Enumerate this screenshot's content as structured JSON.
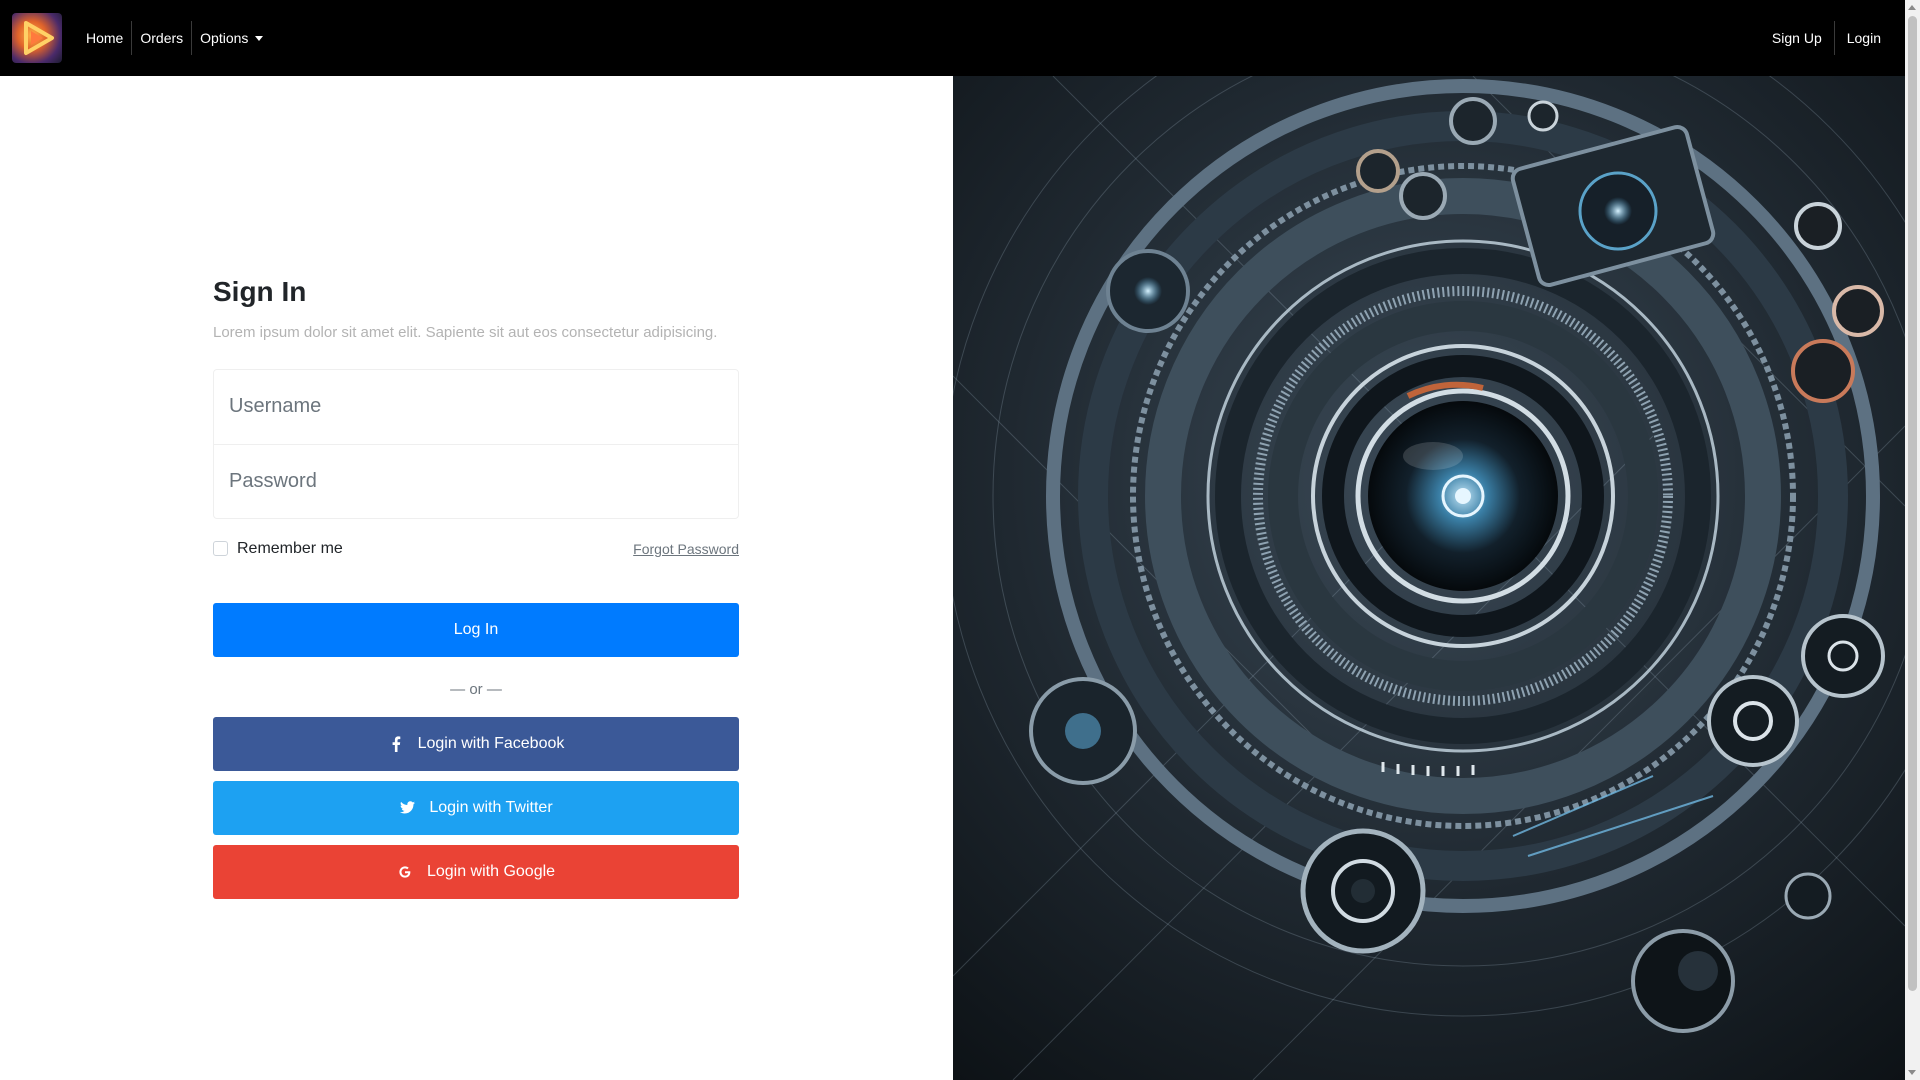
{
  "nav": {
    "logo_icon": "play-logo-icon",
    "left_links": [
      {
        "label": "Home"
      },
      {
        "label": "Orders"
      },
      {
        "label": "Options"
      }
    ],
    "right_links": [
      {
        "label": "Sign Up"
      },
      {
        "label": "Login"
      }
    ]
  },
  "form": {
    "title": "Sign In",
    "subtitle": "Lorem ipsum dolor sit amet elit. Sapiente sit aut eos consectetur adipisicing.",
    "username_placeholder": "Username",
    "username_value": "",
    "password_placeholder": "Password",
    "password_value": "",
    "remember_label": "Remember me",
    "remember_checked": false,
    "forgot_label": "Forgot Password",
    "login_label": "Log In",
    "or_label": "— or —",
    "facebook_label": "Login with Facebook",
    "twitter_label": "Login with Twitter",
    "google_label": "Login with Google"
  },
  "colors": {
    "navbar": "#000000",
    "primary": "#007bff",
    "facebook": "#3b5998",
    "twitter": "#1da1f2",
    "google": "#ea4335"
  },
  "icons": {
    "facebook": "facebook-icon",
    "twitter": "twitter-icon",
    "google": "google-icon",
    "caret": "chevron-down-icon"
  },
  "artwork": "futuristic-camera-lens-illustration"
}
